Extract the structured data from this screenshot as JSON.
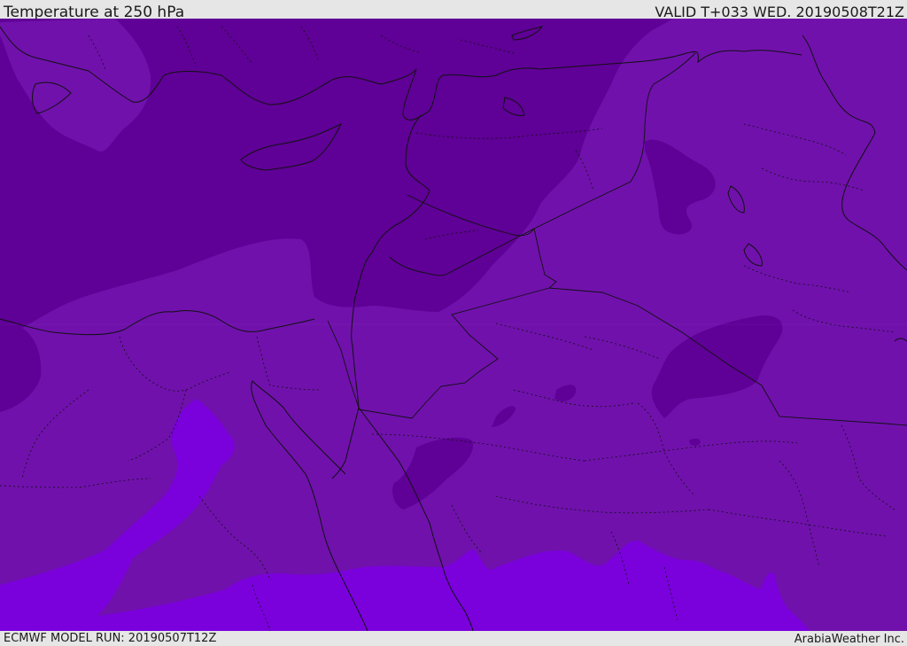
{
  "header": {
    "title": "Temperature at 250 hPa",
    "valid": "VALID T+033 WED. 20190508T21Z"
  },
  "footer": {
    "model_run": "ECMWF MODEL RUN: 20190507T12Z",
    "credit": "ArabiaWeather Inc."
  },
  "map": {
    "field": "temperature",
    "level": "250 hPa",
    "colors": {
      "coldest": "#5f0096",
      "cold": "#7011ac",
      "warm": "#7a00dc",
      "boundary": "#111111"
    }
  }
}
